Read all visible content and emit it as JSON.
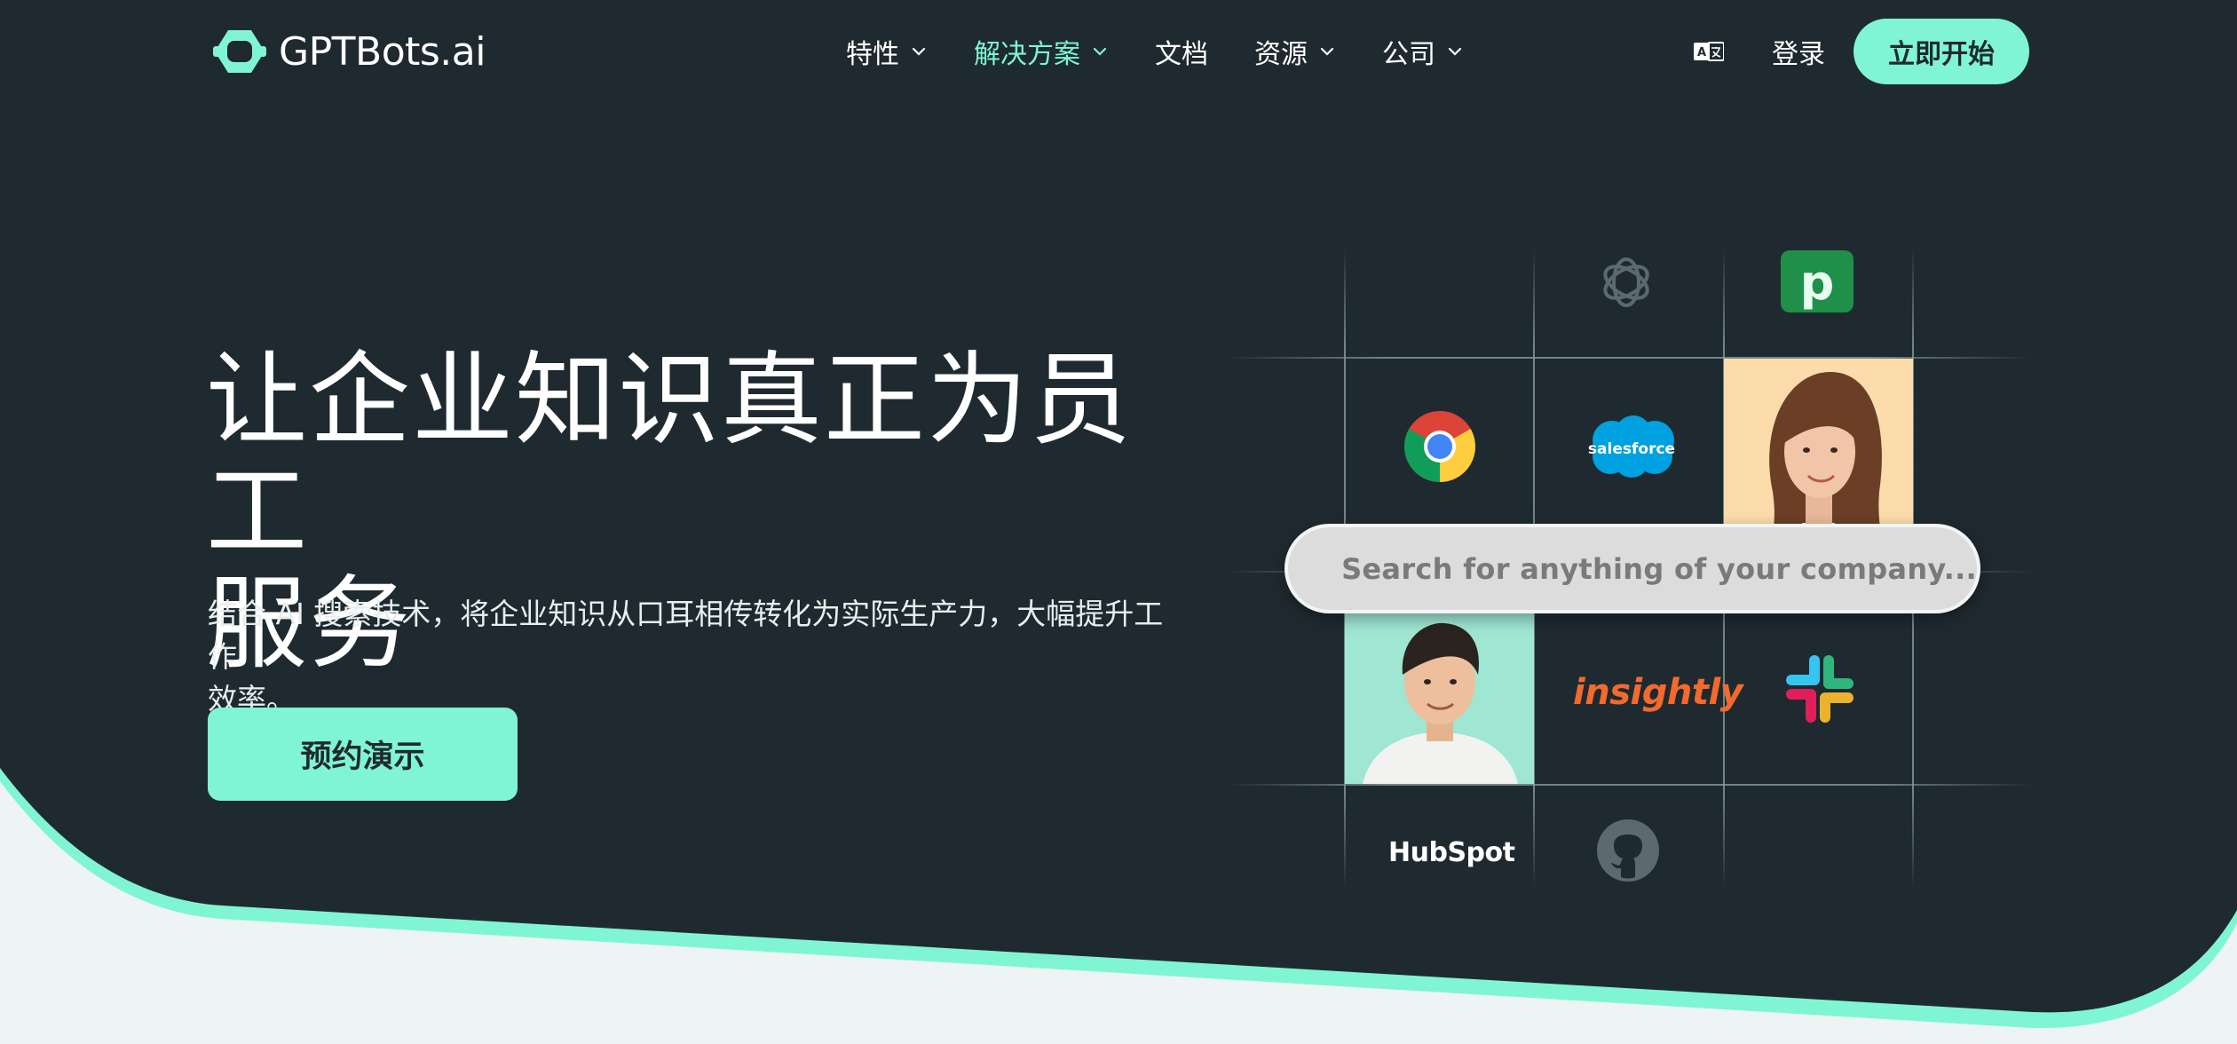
{
  "header": {
    "logo_text": "GPTBots.ai",
    "nav": [
      {
        "label": "特性",
        "has_dropdown": true,
        "active": false
      },
      {
        "label": "解决方案",
        "has_dropdown": true,
        "active": true
      },
      {
        "label": "文档",
        "has_dropdown": false,
        "active": false
      },
      {
        "label": "资源",
        "has_dropdown": true,
        "active": false
      },
      {
        "label": "公司",
        "has_dropdown": true,
        "active": false
      }
    ],
    "language_icon": "translate-icon",
    "login_label": "登录",
    "cta_label": "立即开始"
  },
  "hero": {
    "title_line1": "让企业知识真正为员工",
    "title_line2": "服务",
    "subtitle_line1": "结合 AI 搜索技术，将企业知识从口耳相传转化为实际生产力，大幅提升工作",
    "subtitle_line2": "效率。",
    "button_label": "预约演示"
  },
  "integrations": {
    "search_placeholder": "Search for anything of your company...",
    "logos": [
      "openai-icon",
      "pipedrive-icon",
      "chrome-icon",
      "salesforce-icon",
      "insightly-icon",
      "slack-icon",
      "hubspot-icon",
      "github-icon"
    ],
    "salesforce_text": "salesforce",
    "insightly_text": "insightly",
    "hubspot_text": "HubSpot",
    "pipedrive_text": "p"
  },
  "colors": {
    "background_dark": "#1f2a30",
    "accent": "#7ff5d3",
    "page_light": "#eef4f3"
  }
}
